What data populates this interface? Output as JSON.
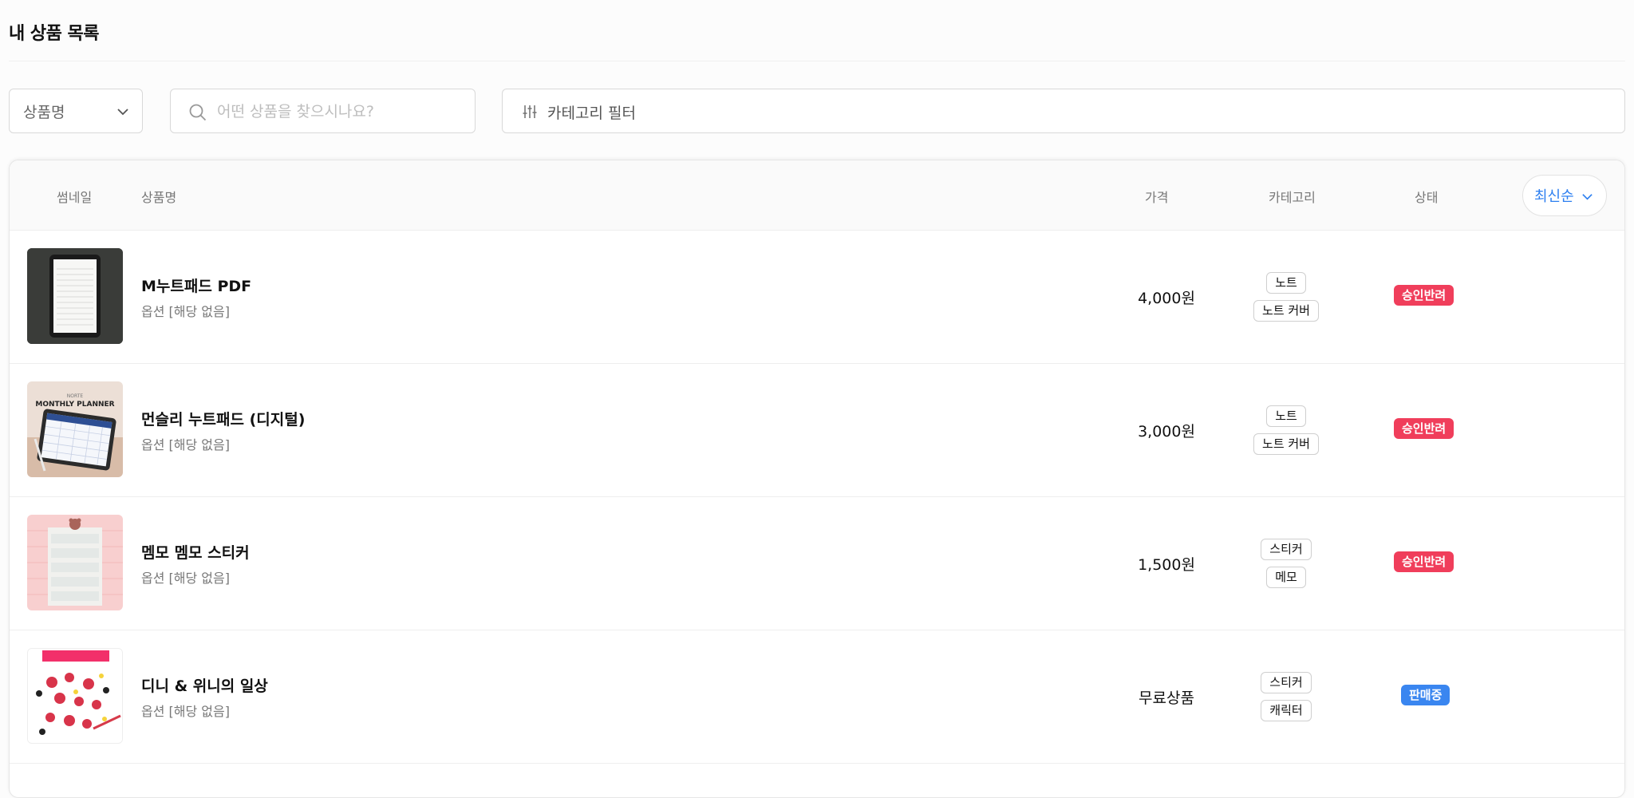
{
  "page": {
    "title": "내 상품 목록"
  },
  "filters": {
    "select_value": "상품명",
    "search_placeholder": "어떤 상품을 찾으시나요?",
    "category_filter_label": "카테고리 필터"
  },
  "table": {
    "headers": {
      "thumbnail": "썸네일",
      "name": "상품명",
      "price": "가격",
      "category": "카테고리",
      "status": "상태"
    },
    "sort_label": "최신순",
    "rows": [
      {
        "name": "M누트패드 PDF",
        "option": "옵션 [해당 없음]",
        "price": "4,000원",
        "categories": [
          "노트",
          "노트 커버"
        ],
        "status": "승인반려",
        "thumb_text": ""
      },
      {
        "name": "먼슬리 누트패드 (디지털)",
        "option": "옵션 [해당 없음]",
        "price": "3,000원",
        "categories": [
          "노트",
          "노트 커버"
        ],
        "status": "승인반려",
        "thumb_text": "MONTHLY PLANNER"
      },
      {
        "name": "멤모 멤모 스티커",
        "option": "옵션 [해당 없음]",
        "price": "1,500원",
        "categories": [
          "스티커",
          "메모"
        ],
        "status": "승인반려",
        "thumb_text": ""
      },
      {
        "name": "디니 & 위니의 일상",
        "option": "옵션 [해당 없음]",
        "price": "무료상품",
        "categories": [
          "스티커",
          "캐릭터"
        ],
        "status": "판매중",
        "thumb_text": ""
      }
    ]
  },
  "colors": {
    "rejected": "#f03e5b",
    "on_sale": "#3a86f0",
    "accent": "#2d7ff0"
  }
}
